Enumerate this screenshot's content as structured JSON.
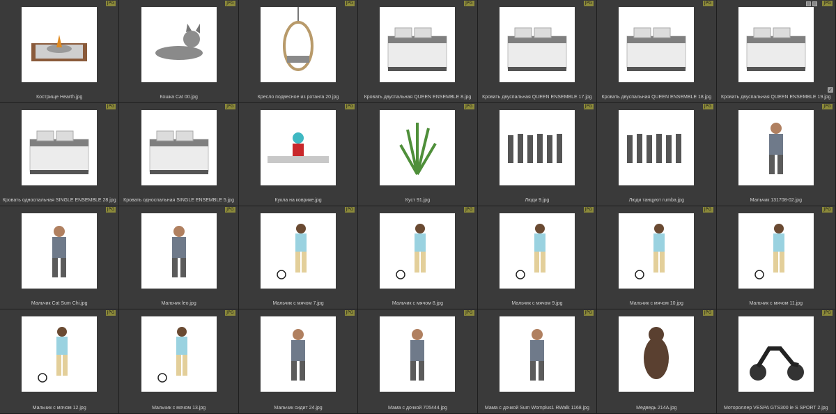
{
  "badge_label": "JPG",
  "items": [
    {
      "name": "Кострище Hearth.jpg",
      "icon": "firepit"
    },
    {
      "name": "Кошка Cat 00.jpg",
      "icon": "cat"
    },
    {
      "name": "Кресло подвесное из ротанга 20.jpg",
      "icon": "hanging-chair"
    },
    {
      "name": "Кровать двуспальная QUEEN ENSEMBLE 8.jpg",
      "icon": "bed"
    },
    {
      "name": "Кровать двуспальная QUEEN ENSEMBLE 17.jpg",
      "icon": "bed"
    },
    {
      "name": "Кровать двуспальная QUEEN ENSEMBLE 18.jpg",
      "icon": "bed"
    },
    {
      "name": "Кровать двуспальная QUEEN ENSEMBLE 19.jpg",
      "icon": "bed"
    },
    {
      "name": "Кровать односпальная SINGLE ENSEMBLE 28.jpg",
      "icon": "bed"
    },
    {
      "name": "Кровать односпальная SINGLE ENSEMBLE 5.jpg",
      "icon": "bed"
    },
    {
      "name": "Кукла на коврике.jpg",
      "icon": "doll"
    },
    {
      "name": "Куст 91.jpg",
      "icon": "bush"
    },
    {
      "name": "Люди 9.jpg",
      "icon": "people"
    },
    {
      "name": "Люди танцуют rumba.jpg",
      "icon": "people"
    },
    {
      "name": "Мальчик 131708-02.jpg",
      "icon": "person"
    },
    {
      "name": "Мальчик Cat Sum Chi.jpg",
      "icon": "person"
    },
    {
      "name": "Мальчик leo.jpg",
      "icon": "person"
    },
    {
      "name": "Мальчик с мячом 7.jpg",
      "icon": "person-ball"
    },
    {
      "name": "Мальчик с мячом 8.jpg",
      "icon": "person-ball"
    },
    {
      "name": "Мальчик с мячом 9.jpg",
      "icon": "person-ball"
    },
    {
      "name": "Мальчик с мячом 10.jpg",
      "icon": "person-ball"
    },
    {
      "name": "Мальчик с мячом 11.jpg",
      "icon": "person-ball"
    },
    {
      "name": "Мальчик с мячом 12.jpg",
      "icon": "person-ball"
    },
    {
      "name": "Мальчик с мячом 13.jpg",
      "icon": "person-ball"
    },
    {
      "name": "Мальчик сидит 24.jpg",
      "icon": "person"
    },
    {
      "name": "Мама с дочкой 705444.jpg",
      "icon": "person"
    },
    {
      "name": "Мама с дочкой Sum Womplus1 RWalk 1168.jpg",
      "icon": "person"
    },
    {
      "name": "Медведь 214A.jpg",
      "icon": "bear"
    },
    {
      "name": "Мотороллер VESPA GTS300 ie S SPORT 2.jpg",
      "icon": "scooter"
    }
  ]
}
